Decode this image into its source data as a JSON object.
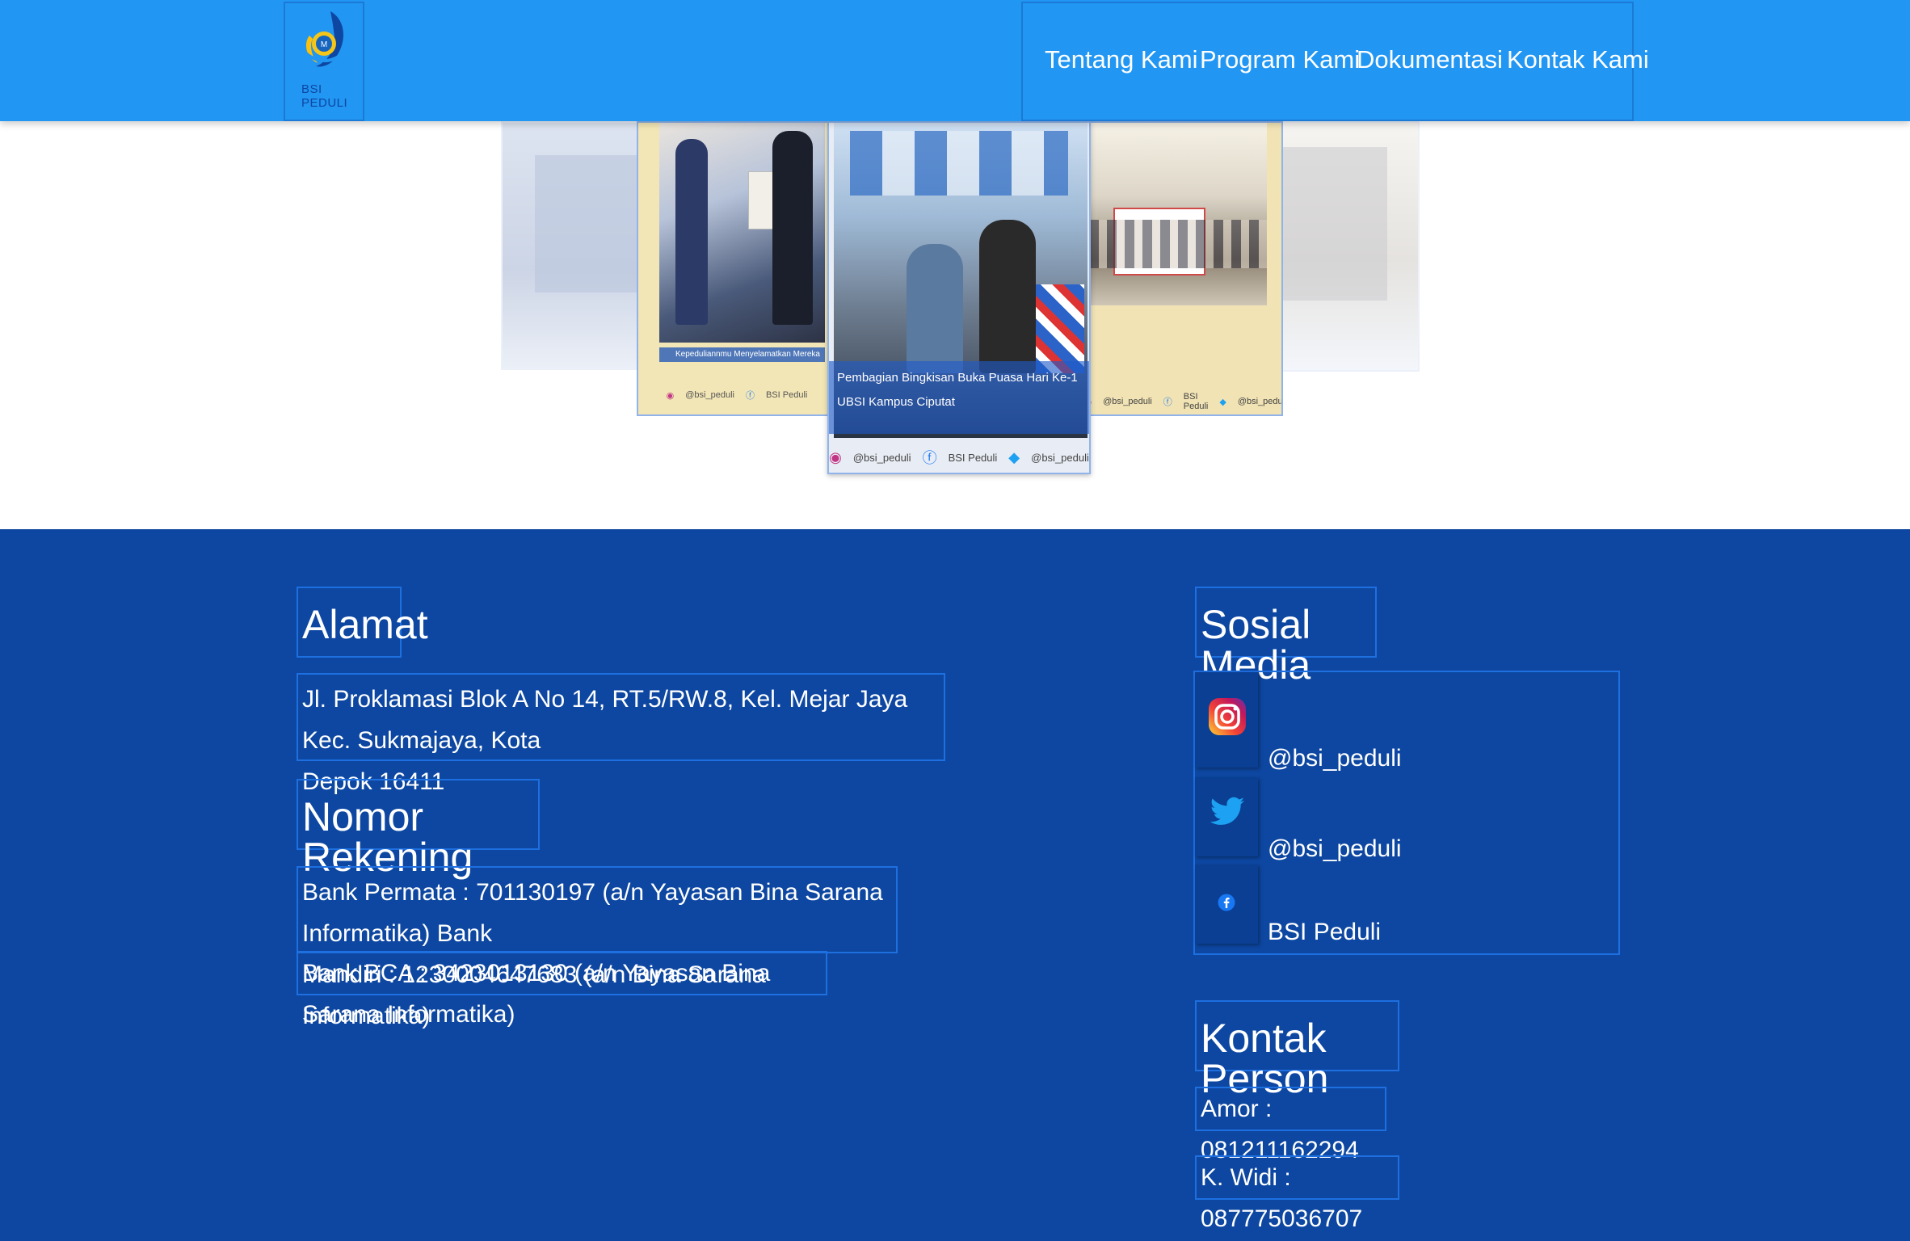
{
  "brand": {
    "logo_text": "BSI PEDULI"
  },
  "nav": {
    "items": [
      {
        "label": "Tentang Kami"
      },
      {
        "label": "Program Kami"
      },
      {
        "label": "Dokumentasi"
      },
      {
        "label": "Kontak Kami"
      }
    ]
  },
  "carousel": {
    "left_slide_caption": "Kepeduliannmu Menyelamatkan Mereka",
    "center_caption": "Pembagian Bingkisan Buka Puasa Hari Ke-1 UBSI Kampus Ciputat",
    "social_instagram": "@bsi_peduli",
    "social_facebook": "BSI Peduli",
    "social_twitter": "@bsi_peduli"
  },
  "footer": {
    "alamat": {
      "title": "Alamat",
      "line1": "Jl. Proklamasi Blok A No 14, RT.5/RW.8, Kel. Mejar Jaya Kec. Sukmajaya, Kota",
      "line2": "Depok 16411"
    },
    "rekening": {
      "title": "Nomor Rekening",
      "line1": "Bank Permata : 701130197 (a/n Yayasan Bina Sarana Informatika) Bank",
      "line2": "Mandiri : 1230004647683 (a/n Bina Sarana Informatika)",
      "line3": "Bank BCA : 3423013130 (a/n Yayasan Bina Sarana Informatika)"
    },
    "sosial": {
      "title": "Sosial Media",
      "items": [
        {
          "icon": "instagram-icon",
          "label": "@bsi_peduli"
        },
        {
          "icon": "twitter-icon",
          "label": "@bsi_peduli"
        },
        {
          "icon": "facebook-icon",
          "label": "BSI Peduli"
        }
      ]
    },
    "kontak": {
      "title": "Kontak Person",
      "items": [
        {
          "label": "Amor : 081211162294"
        },
        {
          "label": "K. Widi : 087775036707"
        }
      ]
    }
  },
  "colors": {
    "navbar": "#2196f3",
    "footer": "#0d47a1",
    "outline": "#1e6fe0"
  }
}
